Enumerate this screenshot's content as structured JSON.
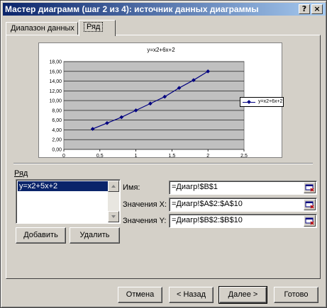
{
  "window": {
    "title": "Мастер диаграмм (шаг 2 из 4): источник данных диаграммы",
    "help_label": "?",
    "close_label": "×"
  },
  "tabs": [
    {
      "label": "Диапазон данных"
    },
    {
      "label": "Ряд"
    }
  ],
  "chart_data": {
    "type": "line",
    "title": "y=x2+6x+2",
    "x": [
      0.4,
      0.6,
      0.8,
      1.0,
      1.2,
      1.4,
      1.6,
      1.8,
      2.0
    ],
    "series": [
      {
        "name": "y=x2+6x+2",
        "values": [
          4.2,
          5.4,
          6.6,
          8.0,
          9.4,
          10.8,
          12.6,
          14.2,
          16.0
        ]
      }
    ],
    "x_ticks": [
      "0",
      "0,5",
      "1",
      "1,5",
      "2",
      "2,5"
    ],
    "y_ticks": [
      "0,00",
      "2,00",
      "4,00",
      "6,00",
      "8,00",
      "10,00",
      "12,00",
      "14,00",
      "16,00",
      "18,00"
    ],
    "xlim": [
      0,
      2.5
    ],
    "ylim": [
      0,
      18
    ],
    "grid": true,
    "legend": "right",
    "colors": {
      "line": "#000080",
      "plot_bg": "#c0c0c0"
    }
  },
  "series_section": {
    "label": "Ряд",
    "items": [
      "y=x2+5x+2"
    ],
    "add_label": "Добавить",
    "remove_label": "Удалить"
  },
  "fields": {
    "name_label": "Имя:",
    "name_value": "=Диагр!$B$1",
    "x_label": "Значения X:",
    "x_value": "=Диагр!$A$2:$A$10",
    "y_label": "Значения Y:",
    "y_value": "=Диагр!$B$2:$B$10"
  },
  "footer": {
    "cancel": "Отмена",
    "back": "< Назад",
    "next": "Далее >",
    "finish": "Готово"
  }
}
